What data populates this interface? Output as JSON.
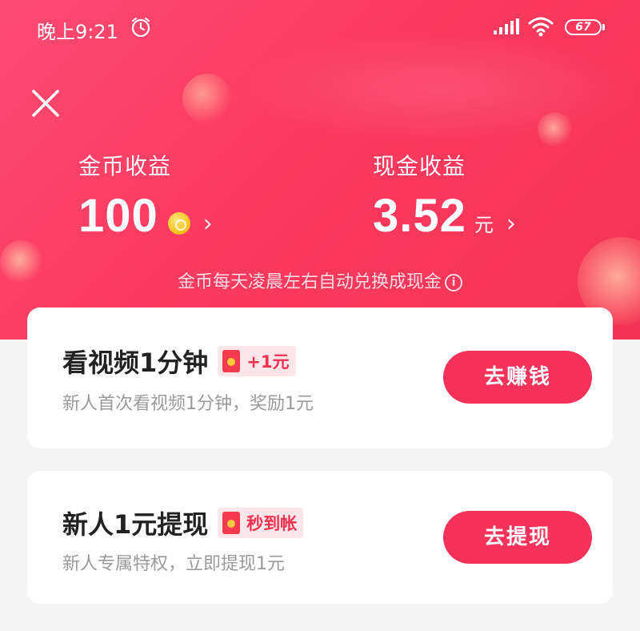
{
  "status_bar": {
    "time": "晚上9:21",
    "battery": "67",
    "icons": [
      "alarm-icon",
      "signal-icon",
      "wifi-icon",
      "battery-icon"
    ]
  },
  "header": {
    "close_icon": "close-icon",
    "coins": {
      "label": "金币收益",
      "value": "100",
      "chevron": "›"
    },
    "cash": {
      "label": "现金收益",
      "value": "3.52",
      "unit": "元",
      "chevron": "›"
    },
    "note": "金币每天凌晨左右自动兑换成现金"
  },
  "tasks": [
    {
      "title": "看视频1分钟",
      "tag": "+1元",
      "description": "新人首次看视频1分钟，奖励1元",
      "button": "去赚钱"
    },
    {
      "title": "新人1元提现",
      "tag": "秒到帐",
      "description": "新人专属特权，立即提现1元",
      "button": "去提现"
    }
  ],
  "colors": {
    "accent": "#f7325a",
    "hero_gradient_start": "#fe4a72",
    "hero_gradient_end": "#f43456",
    "tag_bg": "#fde6ea",
    "tag_text": "#f2304f"
  }
}
